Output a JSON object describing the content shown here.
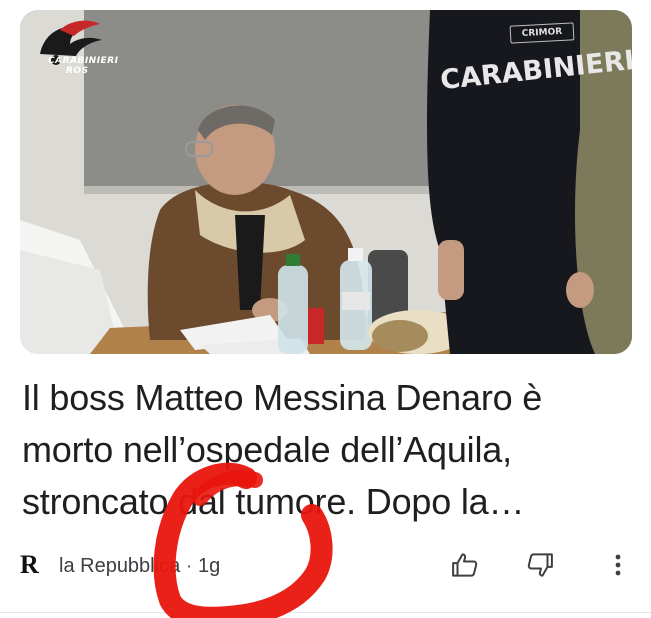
{
  "hero": {
    "logo_line1": "CARABINIERI",
    "logo_line2": "ROS",
    "vest_text": "CARABINIERI",
    "patch_text": "CRIMOR"
  },
  "headline": "Il boss Matteo Messina Denaro è morto nell’ospedale dell’Aquila, stroncato dal tumore. Dopo la…",
  "footer": {
    "publisher_logo": "R",
    "publisher_name": "la Repubblica",
    "separator": "·",
    "age": "1g"
  },
  "icons": {
    "like": "thumb-up-icon",
    "dislike": "thumb-down-icon",
    "more": "more-vert-icon"
  },
  "colors": {
    "annotation_red": "#e8150c",
    "text": "#1f1f1f",
    "meta_text": "#3c4043"
  }
}
